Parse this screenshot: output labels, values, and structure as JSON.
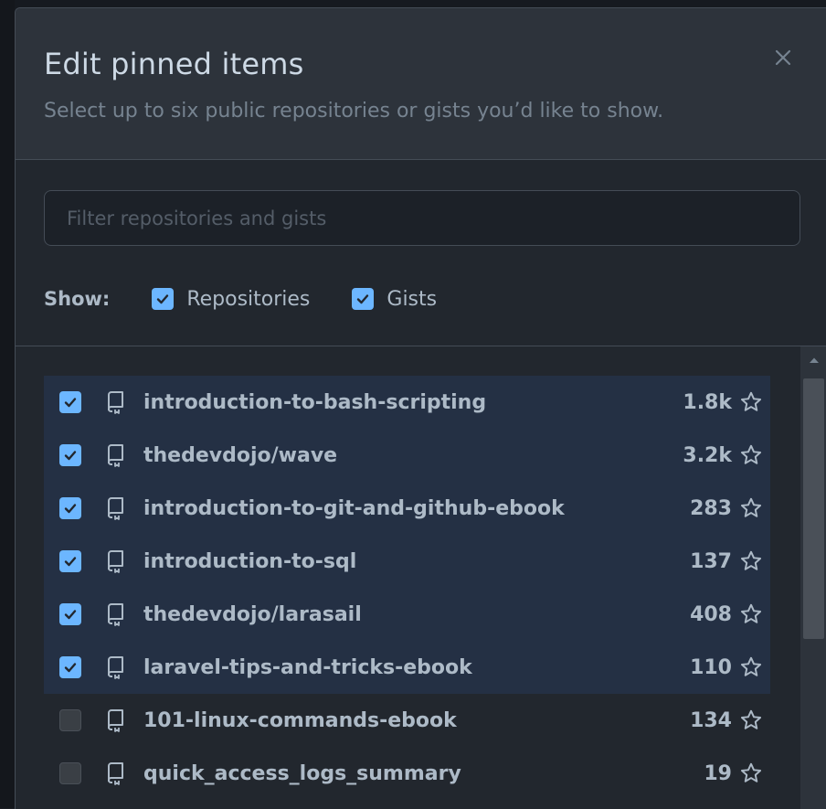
{
  "dialog": {
    "title": "Edit pinned items",
    "subtitle": "Select up to six public repositories or gists you’d like to show.",
    "close_icon": "x-icon"
  },
  "filter": {
    "placeholder": "Filter repositories and gists",
    "value": ""
  },
  "show": {
    "label": "Show:",
    "options": [
      {
        "label": "Repositories",
        "checked": true
      },
      {
        "label": "Gists",
        "checked": true
      }
    ]
  },
  "repos": [
    {
      "name": "introduction-to-bash-scripting",
      "stars": "1.8k",
      "checked": true
    },
    {
      "name": "thedevdojo/wave",
      "stars": "3.2k",
      "checked": true
    },
    {
      "name": "introduction-to-git-and-github-ebook",
      "stars": "283",
      "checked": true
    },
    {
      "name": "introduction-to-sql",
      "stars": "137",
      "checked": true
    },
    {
      "name": "thedevdojo/larasail",
      "stars": "408",
      "checked": true
    },
    {
      "name": "laravel-tips-and-tricks-ebook",
      "stars": "110",
      "checked": true
    },
    {
      "name": "101-linux-commands-ebook",
      "stars": "134",
      "checked": false
    },
    {
      "name": "quick_access_logs_summary",
      "stars": "19",
      "checked": false
    }
  ],
  "icons": {
    "repo": "repo-icon",
    "star": "star-icon",
    "checkmark": "checkmark-icon"
  },
  "colors": {
    "accent": "#6cb6ff",
    "selected_row": "#243044",
    "background": "#22272e",
    "header": "#2d333b"
  }
}
